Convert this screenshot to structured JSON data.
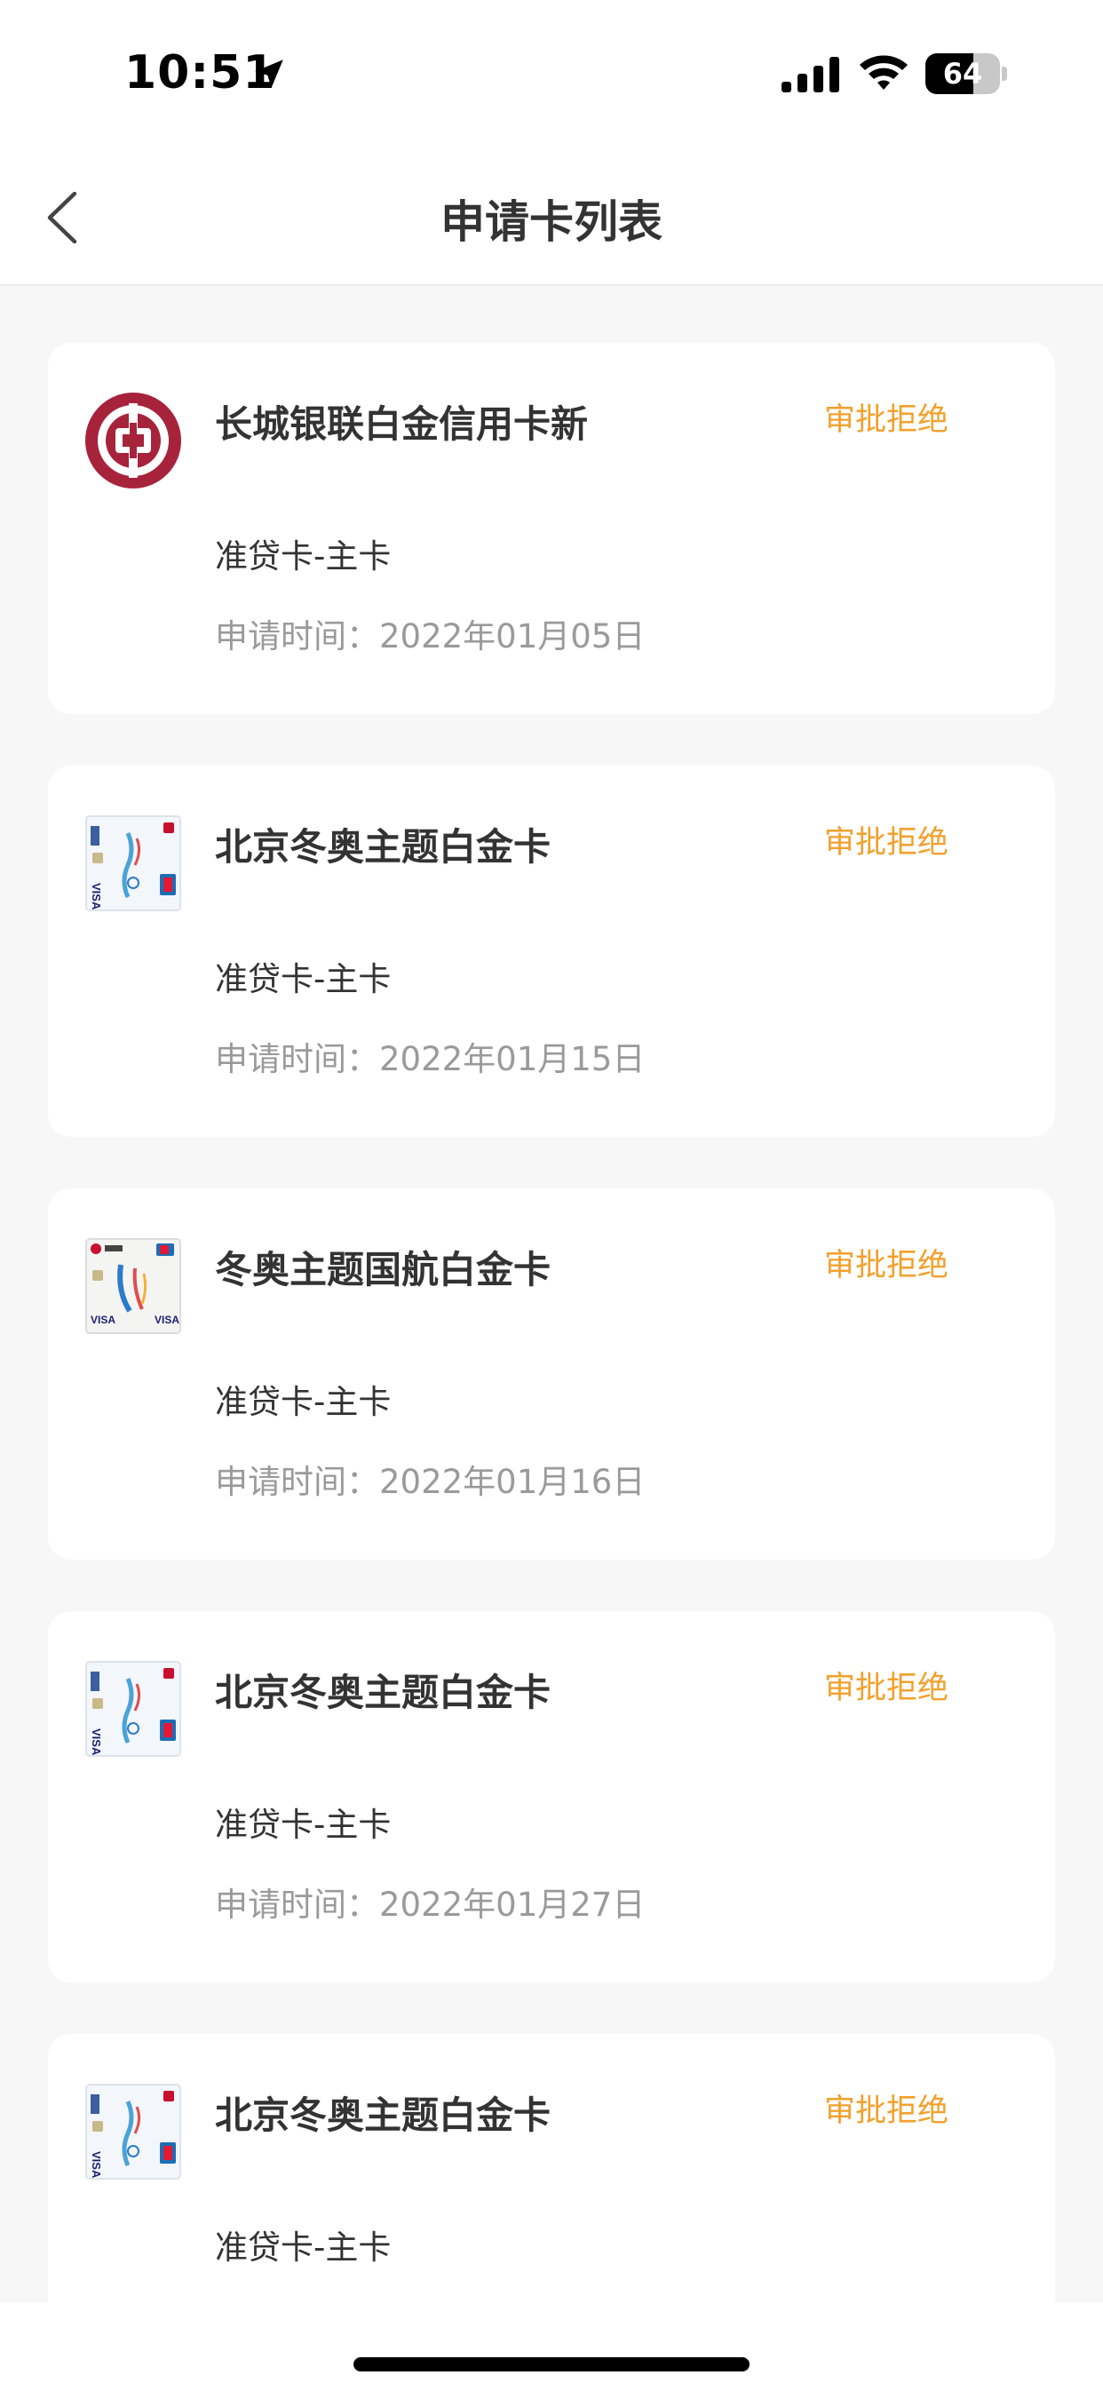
{
  "status_bar": {
    "time": "10:51",
    "battery_level": "64",
    "battery_fraction": 0.64
  },
  "nav": {
    "title": "申请卡列表",
    "back_icon": "chevron-left-icon"
  },
  "colors": {
    "status_accent": "#f3a02c",
    "title_text": "#333333",
    "meta_text": "#9a9a9a",
    "bank_logo_red": "#a7233b"
  },
  "cards": [
    {
      "logo": "bank-of-china-logo",
      "name": "长城银联白金信用卡新",
      "status": "审批拒绝",
      "type": "准贷卡-主卡",
      "date": "申请时间：2022年01月05日"
    },
    {
      "logo": "winter-olympics-card-image",
      "name": "北京冬奥主题白金卡",
      "status": "审批拒绝",
      "type": "准贷卡-主卡",
      "date": "申请时间：2022年01月15日"
    },
    {
      "logo": "air-china-olympics-card-image",
      "name": "冬奥主题国航白金卡",
      "status": "审批拒绝",
      "type": "准贷卡-主卡",
      "date": "申请时间：2022年01月16日"
    },
    {
      "logo": "winter-olympics-card-image",
      "name": "北京冬奥主题白金卡",
      "status": "审批拒绝",
      "type": "准贷卡-主卡",
      "date": "申请时间：2022年01月27日"
    },
    {
      "logo": "winter-olympics-card-image",
      "name": "北京冬奥主题白金卡",
      "status": "审批拒绝",
      "type": "准贷卡-主卡",
      "date": ""
    }
  ]
}
